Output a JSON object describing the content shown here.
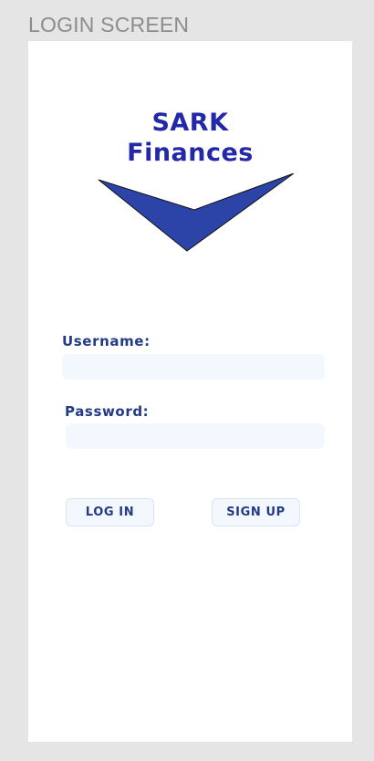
{
  "frame": {
    "label": "LOGIN SCREEN"
  },
  "brand": {
    "line1": "SARK",
    "line2": "Finances",
    "color": "#2228a8",
    "logo_fill": "#2c44a8"
  },
  "form": {
    "username_label": "Username:",
    "username_value": "",
    "password_label": "Password:",
    "password_value": ""
  },
  "actions": {
    "login_label": "LOG IN",
    "signup_label": "SIGN UP"
  }
}
